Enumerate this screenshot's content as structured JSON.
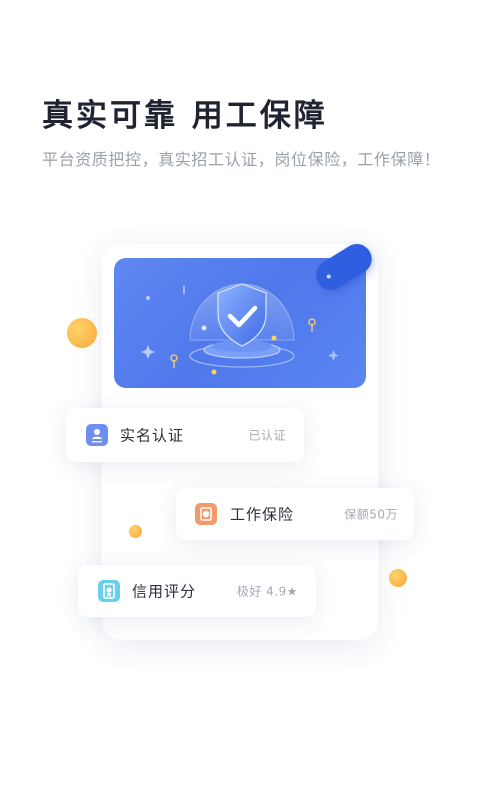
{
  "hero": {
    "title": "真实可靠  用工保障",
    "subtitle": "平台资质把控，真实招工认证，岗位保险，工作保障！"
  },
  "features": [
    {
      "label": "实名认证",
      "status": "已认证",
      "icon": "id-card-icon",
      "color": "#6f8ff0"
    },
    {
      "label": "工作保险",
      "status": "保额50万",
      "icon": "insurance-document-icon",
      "color": "#f39a6c"
    },
    {
      "label": "信用评分",
      "status": "极好  4.9★",
      "icon": "credit-badge-icon",
      "color": "#6ad0ea"
    }
  ],
  "colors": {
    "banner": "#5a82ef",
    "accent_ball": "#f7b14a",
    "title": "#1f2430",
    "subtitle": "#9aa0a8"
  }
}
